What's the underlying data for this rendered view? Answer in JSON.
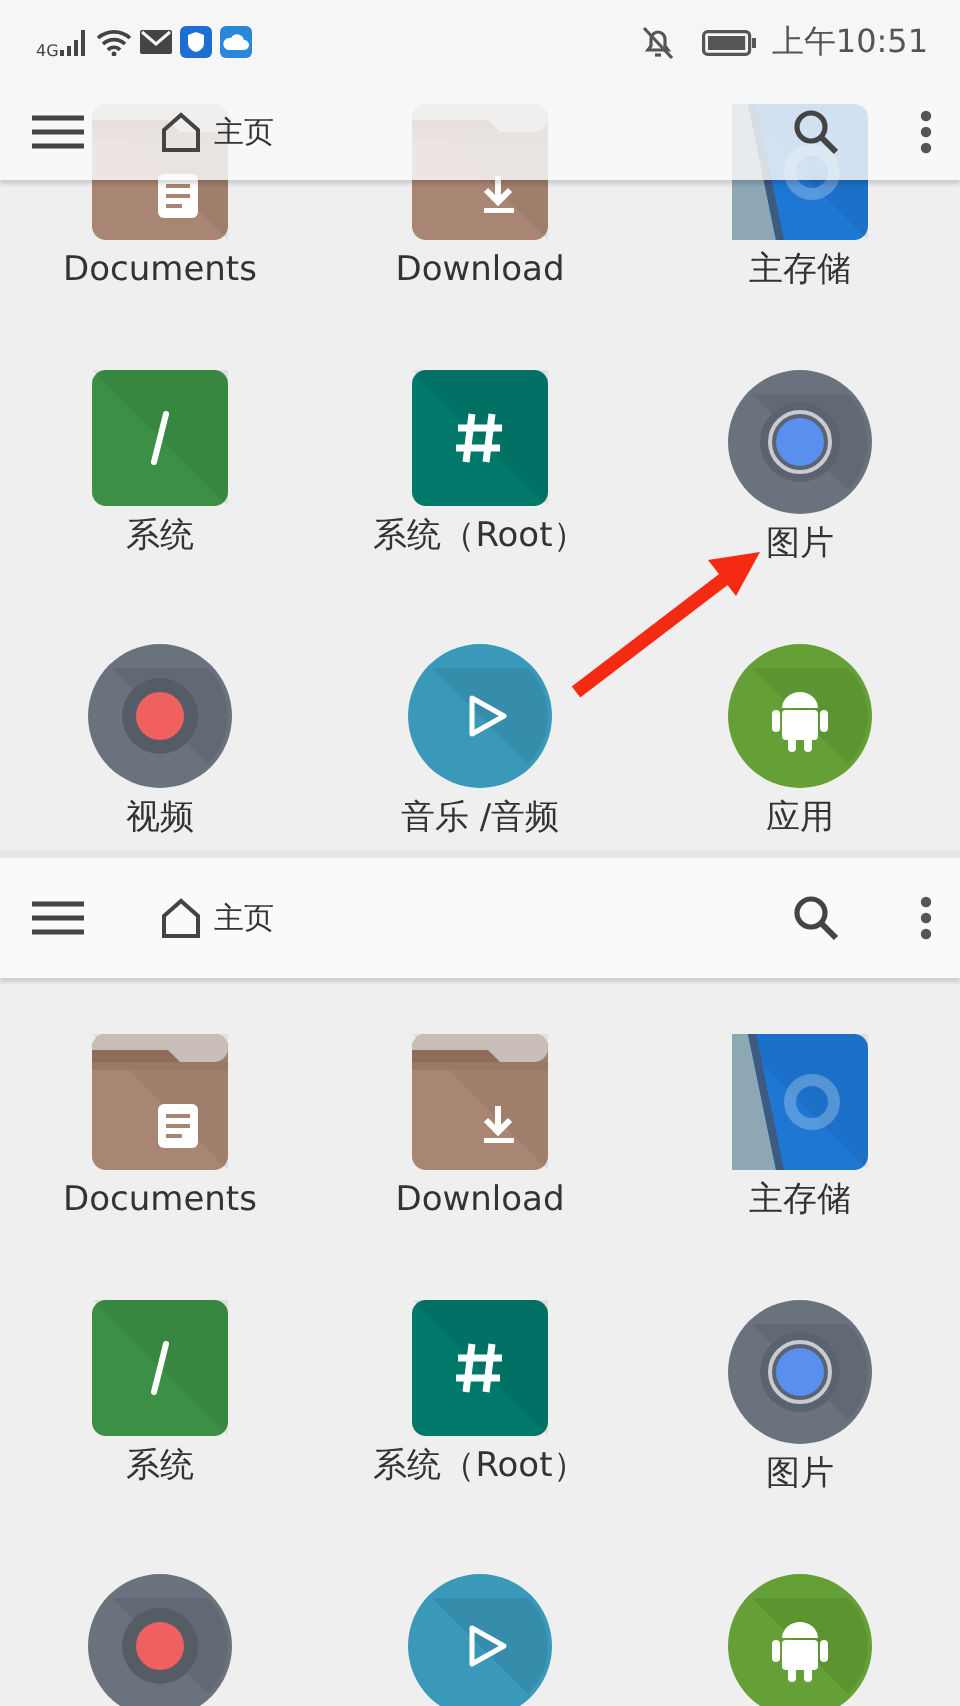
{
  "status_bar": {
    "network": "4G",
    "time": "上午10:51"
  },
  "panels": [
    {
      "toolbar": {
        "title": "主页",
        "overlay": true
      },
      "annotation_arrow": true,
      "items": [
        {
          "kind": "documents",
          "label": "Documents"
        },
        {
          "kind": "download",
          "label": "Download"
        },
        {
          "kind": "storage",
          "label": "主存储"
        },
        {
          "kind": "system",
          "label": "系统"
        },
        {
          "kind": "root",
          "label": "系统（Root）"
        },
        {
          "kind": "pictures",
          "label": "图片"
        },
        {
          "kind": "video",
          "label": "视频"
        },
        {
          "kind": "music",
          "label": "音乐 /音频"
        },
        {
          "kind": "apps",
          "label": "应用"
        }
      ]
    },
    {
      "toolbar": {
        "title": "主页",
        "overlay": false
      },
      "items": [
        {
          "kind": "documents",
          "label": "Documents"
        },
        {
          "kind": "download",
          "label": "Download"
        },
        {
          "kind": "storage",
          "label": "主存储"
        },
        {
          "kind": "system",
          "label": "系统"
        },
        {
          "kind": "root",
          "label": "系统（Root）"
        },
        {
          "kind": "pictures",
          "label": "图片"
        },
        {
          "kind": "video"
        },
        {
          "kind": "music"
        },
        {
          "kind": "apps"
        }
      ]
    }
  ]
}
